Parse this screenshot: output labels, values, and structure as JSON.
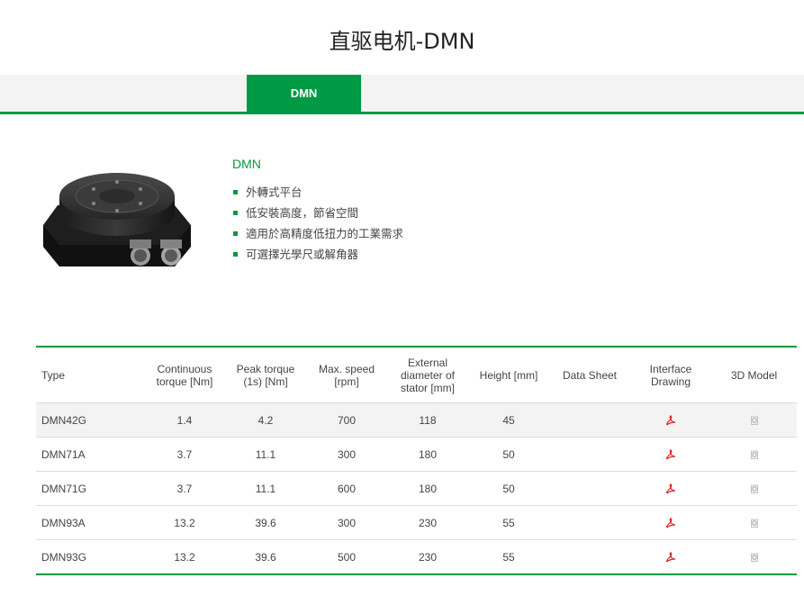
{
  "page": {
    "title": "直驱电机-DMN"
  },
  "tabs": [
    {
      "label": "DMN"
    }
  ],
  "product": {
    "name": "DMN",
    "features": [
      "外轉式平台",
      "低安裝高度，節省空間",
      "適用於高精度低扭力的工業需求",
      "可選擇光學尺或解角器"
    ]
  },
  "table": {
    "headers": {
      "type": "Type",
      "cont": "Continuous\ntorque [Nm]",
      "peak": "Peak torque\n(1s) [Nm]",
      "speed": "Max. speed\n[rpm]",
      "diam": "External\ndiameter of\nstator [mm]",
      "height": "Height [mm]",
      "datasheet": "Data Sheet",
      "interface": "Interface\nDrawing",
      "model": "3D Model"
    },
    "rows": [
      {
        "type": "DMN42G",
        "cont": "1.4",
        "peak": "4.2",
        "speed": "700",
        "diam": "118",
        "height": "45"
      },
      {
        "type": "DMN71A",
        "cont": "3.7",
        "peak": "11.1",
        "speed": "300",
        "diam": "180",
        "height": "50"
      },
      {
        "type": "DMN71G",
        "cont": "3.7",
        "peak": "11.1",
        "speed": "600",
        "diam": "180",
        "height": "50"
      },
      {
        "type": "DMN93A",
        "cont": "13.2",
        "peak": "39.6",
        "speed": "300",
        "diam": "230",
        "height": "55"
      },
      {
        "type": "DMN93G",
        "cont": "13.2",
        "peak": "39.6",
        "speed": "500",
        "diam": "230",
        "height": "55"
      }
    ]
  },
  "colors": {
    "accent": "#009a44",
    "pdf": "#d9231e",
    "tab_bar": "#f3f3f3"
  },
  "icons": {
    "interface": "pdf-icon",
    "model": "3d-model-icon"
  }
}
